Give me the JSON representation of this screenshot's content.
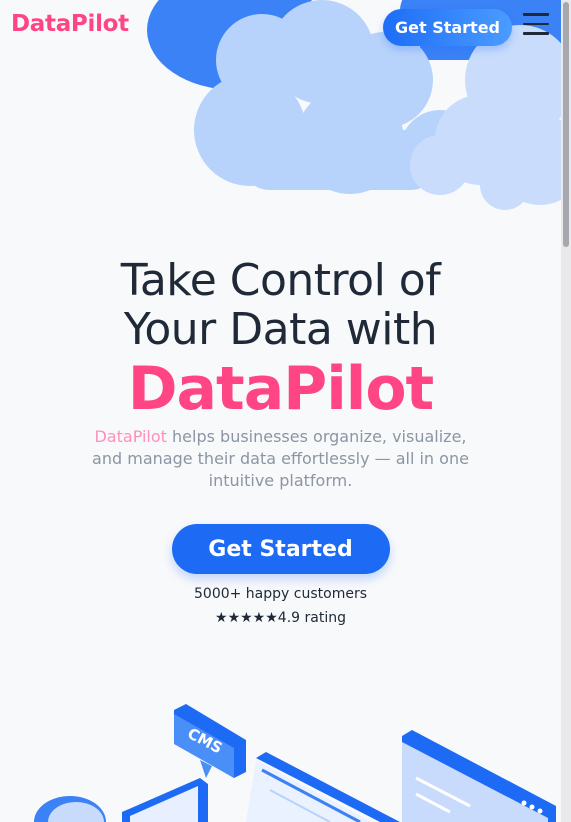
{
  "header": {
    "logo": "DataPilot",
    "cta_label": "Get Started",
    "menu_icon": "hamburger-menu-icon"
  },
  "hero": {
    "headline_line1": "Take Control of",
    "headline_line2": "Your Data with",
    "brand": "DataPilot",
    "sub_brand": "DataPilot",
    "sub_text": " helps businesses organize, visualize, and manage their data effortlessly — all in one intuitive platform.",
    "cta_label": "Get Started",
    "customers": "5000+ happy customers",
    "stars": "★★★★★",
    "rating": "4.9 rating"
  },
  "illustration": {
    "badge_text": "CMS"
  },
  "colors": {
    "brand_pink": "#ff4584",
    "primary_blue": "#1d6af5",
    "cloud_dark": "#3b82f6",
    "cloud_light": "#b8d3fb",
    "text_dark": "#1f2937",
    "text_muted": "#8b95a3"
  }
}
